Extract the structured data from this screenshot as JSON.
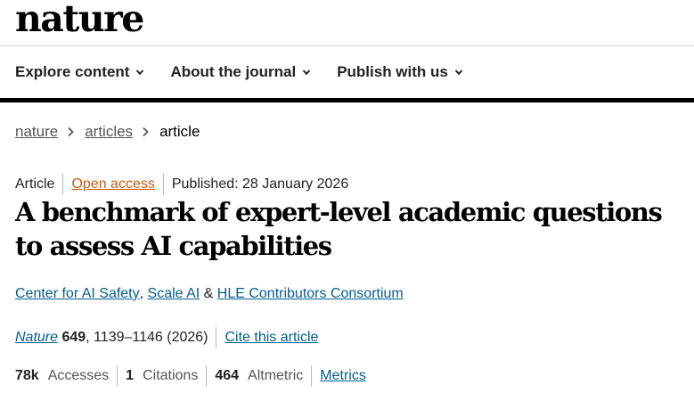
{
  "site": {
    "logo": "nature"
  },
  "nav": {
    "items": [
      {
        "label": "Explore content"
      },
      {
        "label": "About the journal"
      },
      {
        "label": "Publish with us"
      }
    ]
  },
  "breadcrumb": {
    "items": [
      "nature",
      "articles",
      "article"
    ]
  },
  "article": {
    "type": "Article",
    "access": "Open access",
    "published": "Published: 28 January 2026",
    "title": "A benchmark of expert-level academic questions to assess AI capabilities",
    "authors": {
      "a1": "Center for AI Safety",
      "sep1": ", ",
      "a2": "Scale AI",
      "sep2": " & ",
      "a3": "HLE Contributors Consortium"
    },
    "citation": {
      "journal": "Nature",
      "volume": "649",
      "pages_year": ", 1139–1146 (2026)",
      "cite_label": "Cite this article"
    },
    "metrics": {
      "accesses_value": "78k",
      "accesses_label": "Accesses",
      "citations_value": "1",
      "citations_label": "Citations",
      "altmetric_value": "464",
      "altmetric_label": "Altmetric",
      "metrics_link": "Metrics"
    }
  },
  "colors": {
    "link": "#025e8d",
    "open_access": "#c55b12",
    "rule": "#000000"
  },
  "icons": {
    "nav_chevron": "chevron-down-icon",
    "breadcrumb_separator": "chevron-right-icon"
  }
}
